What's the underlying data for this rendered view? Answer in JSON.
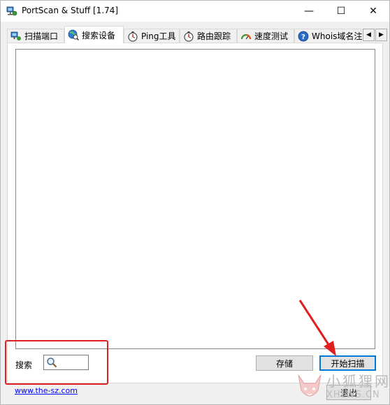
{
  "window": {
    "title": "PortScan & Stuff [1.74]"
  },
  "title_controls": {
    "minimize": "—",
    "maximize": "☐",
    "close": "✕"
  },
  "tabs": [
    {
      "label": "扫描端口",
      "icon": "network-computer-icon",
      "active": false
    },
    {
      "label": "搜索设备",
      "icon": "globe-search-icon",
      "active": true
    },
    {
      "label": "Ping工具",
      "icon": "stopwatch-icon",
      "active": false
    },
    {
      "label": "路由跟踪",
      "icon": "stopwatch-icon",
      "active": false
    },
    {
      "label": "速度测试",
      "icon": "gauge-icon",
      "active": false
    },
    {
      "label": "Whois域名注",
      "icon": "help-icon",
      "active": false
    }
  ],
  "tab_scroll": {
    "left": "◀",
    "right": "▶"
  },
  "search": {
    "label": "搜索",
    "value": "",
    "icon": "magnifier-icon"
  },
  "buttons": {
    "save": "存储",
    "start_scan": "开始扫描",
    "exit": "退出"
  },
  "footer": {
    "link": "www.the-sz.com"
  },
  "watermark": {
    "line1": "小狐狸网",
    "line2": "XHLWS.CN"
  },
  "colors": {
    "annotation_red": "#e02020",
    "focus_blue": "#0078d7",
    "link_blue": "#0000ff"
  }
}
